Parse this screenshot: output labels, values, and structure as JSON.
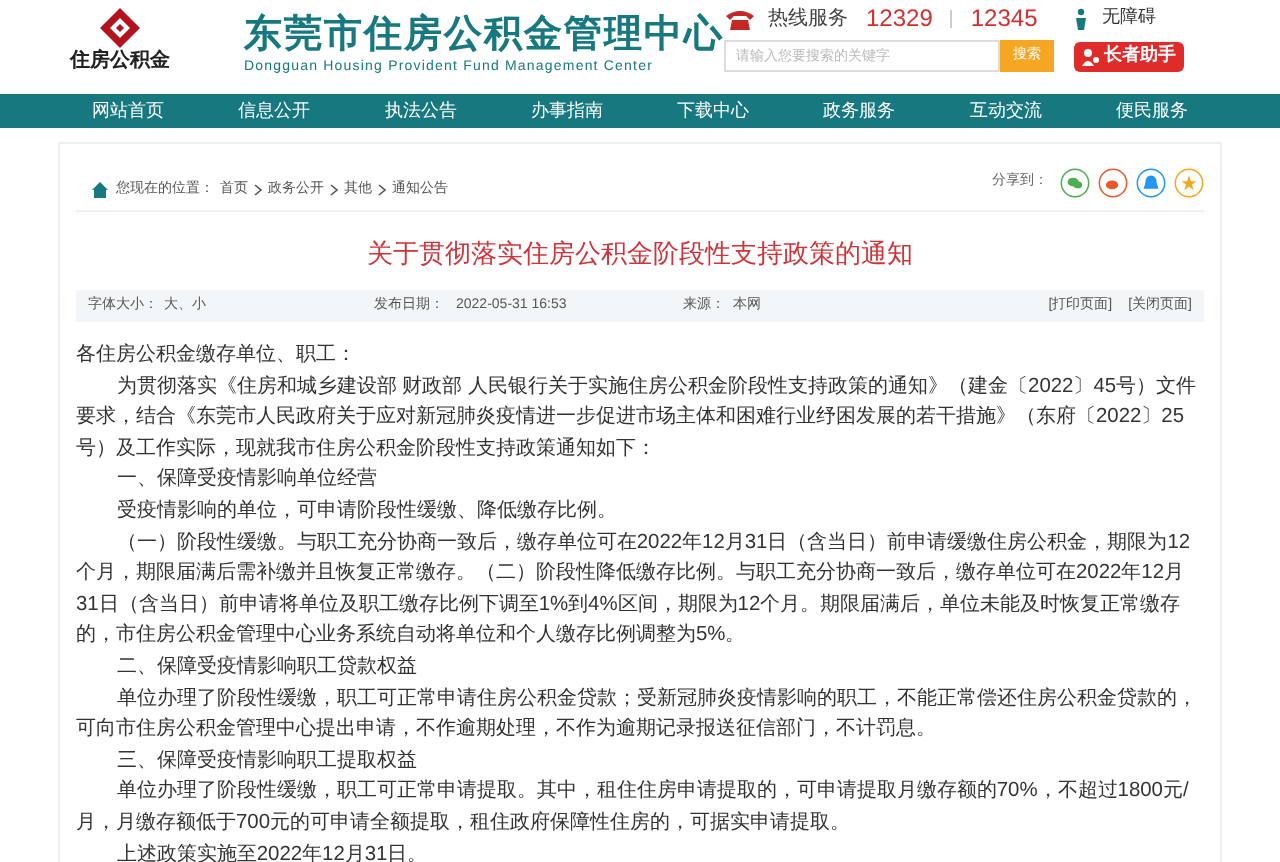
{
  "header": {
    "logo_text": "住房公积金",
    "title": "东莞市住房公积金管理中心",
    "subtitle": "Dongguan Housing Provident Fund Management Center",
    "hotline_label": "热线服务",
    "hotlines": [
      "12329",
      "12345"
    ],
    "accessibility": "无障碍",
    "search": {
      "placeholder": "请输入您要搜索的关键字",
      "button": "搜索"
    },
    "elder_button": "长者助手"
  },
  "nav": [
    {
      "label": "网站首页",
      "selected": false
    },
    {
      "label": "信息公开",
      "selected": false
    },
    {
      "label": "执法公告",
      "selected": false
    },
    {
      "label": "办事指南",
      "selected": false
    },
    {
      "label": "下载中心",
      "selected": false
    },
    {
      "label": "政务服务",
      "selected": false
    },
    {
      "label": "互动交流",
      "selected": false
    },
    {
      "label": "便民服务",
      "selected": false
    }
  ],
  "breadcrumb": {
    "prefix": "您现在的位置：",
    "items": [
      "首页",
      "政务公开",
      "其他",
      "通知公告"
    ]
  },
  "share": {
    "label": "分享到："
  },
  "article": {
    "title": "关于贯彻落实住房公积金阶段性支持政策的通知",
    "meta": {
      "font_size_label": "字体大小：",
      "font_size_options": [
        "大",
        "小"
      ],
      "font_size_separator": "、",
      "date_label": "发布日期：",
      "date": "2022-05-31 16:53",
      "source_label": "来源：",
      "source": "本网",
      "actions": [
        "[打印页面]",
        "[关闭页面]"
      ]
    },
    "paragraphs": [
      {
        "kind": "salutation",
        "text": "各住房公积金缴存单位、职工："
      },
      {
        "kind": "body",
        "text": "为贯彻落实《住房和城乡建设部 财政部 人民银行关于实施住房公积金阶段性支持政策的通知》（建金〔2022〕45号）文件要求，结合《东莞市人民政府关于应对新冠肺炎疫情进一步促进市场主体和困难行业纾困发展的若干措施》（东府〔2022〕25号）及工作实际，现就我市住房公积金阶段性支持政策通知如下："
      },
      {
        "kind": "heading",
        "text": "一、保障受疫情影响单位经营"
      },
      {
        "kind": "body",
        "text": "受疫情影响的单位，可申请阶段性缓缴、降低缴存比例。"
      },
      {
        "kind": "body",
        "text": "（一）阶段性缓缴。与职工充分协商一致后，缴存单位可在2022年12月31日（含当日）前申请缓缴住房公积金，期限为12个月，期限届满后需补缴并且恢复正常缴存。（二）阶段性降低缴存比例。与职工充分协商一致后，缴存单位可在2022年12月31日（含当日）前申请将单位及职工缴存比例下调至1%到4%区间，期限为12个月。期限届满后，单位未能及时恢复正常缴存的，市住房公积金管理中心业务系统自动将单位和个人缴存比例调整为5%。"
      },
      {
        "kind": "heading",
        "text": "二、保障受疫情影响职工贷款权益"
      },
      {
        "kind": "body",
        "text": "单位办理了阶段性缓缴，职工可正常申请住房公积金贷款；受新冠肺炎疫情影响的职工，不能正常偿还住房公积金贷款的，可向市住房公积金管理中心提出申请，不作逾期处理，不作为逾期记录报送征信部门，不计罚息。"
      },
      {
        "kind": "heading",
        "text": "三、保障受疫情影响职工提取权益"
      },
      {
        "kind": "body",
        "text": "单位办理了阶段性缓缴，职工可正常申请提取。其中，租住住房申请提取的，可申请提取月缴存额的70%，不超过1800元/月，月缴存额低于700元的可申请全额提取，租住政府保障性住房的，可据实申请提取。"
      },
      {
        "kind": "body",
        "text": "上述政策实施至2022年12月31日。"
      }
    ]
  }
}
